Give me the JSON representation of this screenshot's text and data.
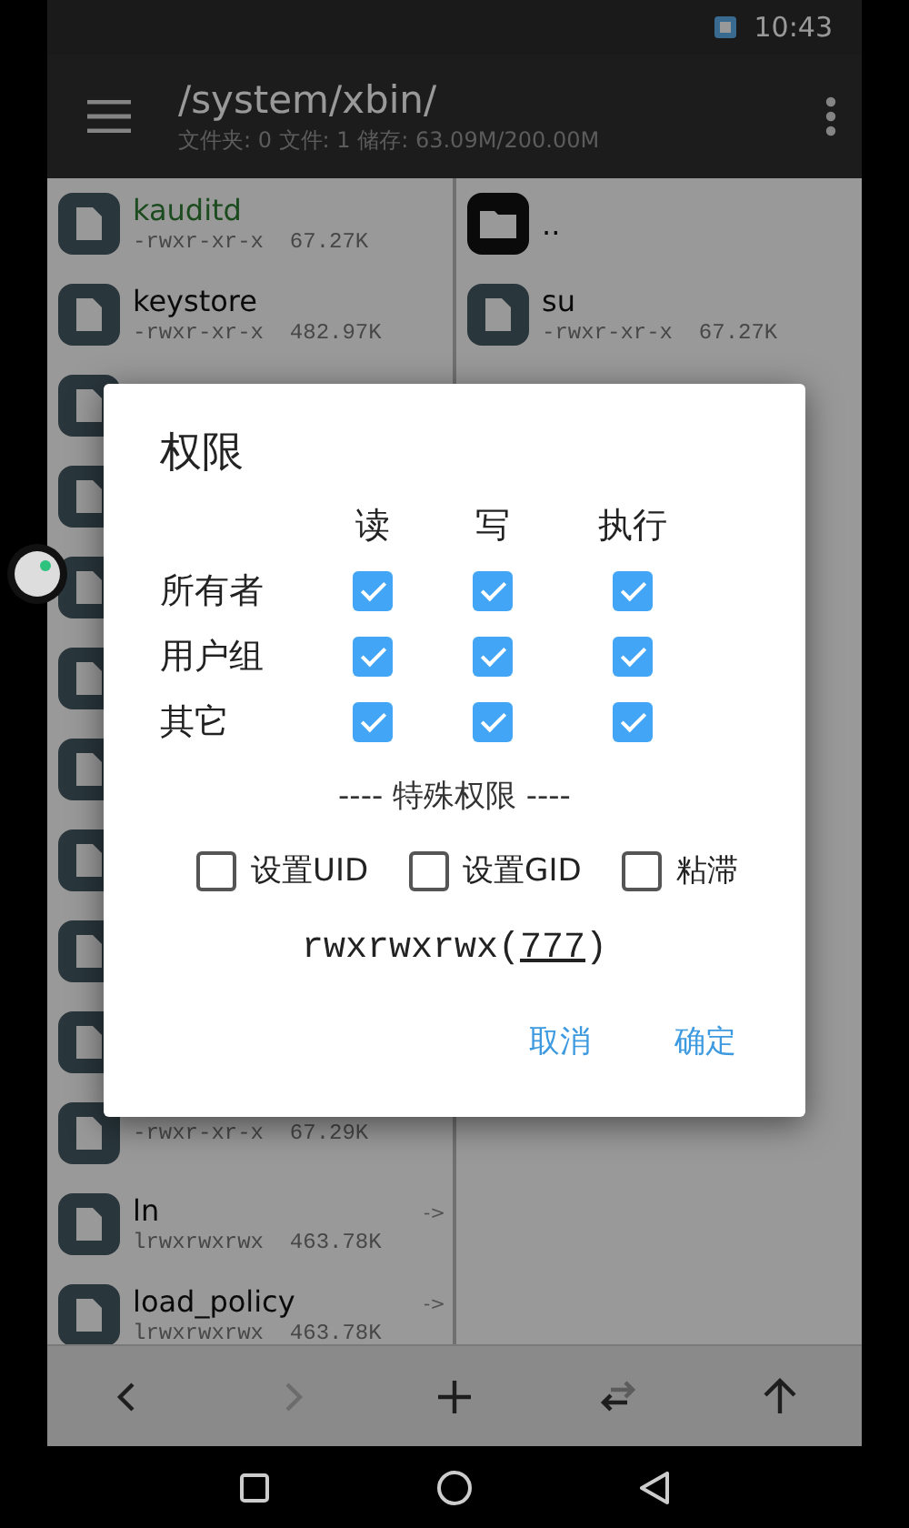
{
  "status_bar": {
    "time": "10:43"
  },
  "toolbar": {
    "path": "/system/xbin/",
    "summary": "文件夹: 0  文件: 1  储存: 63.09M/200.00M"
  },
  "left_pane": {
    "rows": [
      {
        "kind": "file",
        "name": "kauditd",
        "highlighted": true,
        "meta": "-rwxr-xr-x  67.27K"
      },
      {
        "kind": "file",
        "name": "keystore",
        "highlighted": false,
        "meta": "-rwxr-xr-x  482.97K"
      },
      {
        "kind": "file"
      },
      {
        "kind": "file"
      },
      {
        "kind": "file"
      },
      {
        "kind": "file"
      },
      {
        "kind": "file"
      },
      {
        "kind": "file"
      },
      {
        "kind": "file"
      },
      {
        "kind": "file"
      },
      {
        "kind": "file",
        "meta": "-rwxr-xr-x  67.29K"
      },
      {
        "kind": "file",
        "name": "ln",
        "highlighted": false,
        "meta": "lrwxrwxrwx  463.78K",
        "link_mark": "->"
      },
      {
        "kind": "file",
        "name": "load_policy",
        "highlighted": false,
        "meta": "lrwxrwxrwx  463.78K",
        "link_mark": "->"
      }
    ]
  },
  "right_pane": {
    "rows": [
      {
        "kind": "folder",
        "name": ".."
      },
      {
        "kind": "file",
        "name": "su",
        "highlighted": false,
        "meta": "-rwxr-xr-x  67.27K"
      }
    ]
  },
  "dialog": {
    "title": "权限",
    "columns": [
      "读",
      "写",
      "执行"
    ],
    "rows": [
      {
        "label": "所有者",
        "checks": [
          true,
          true,
          true
        ]
      },
      {
        "label": "用户组",
        "checks": [
          true,
          true,
          true
        ]
      },
      {
        "label": "其它",
        "checks": [
          true,
          true,
          true
        ]
      }
    ],
    "special_heading": "---- 特殊权限 ----",
    "special": [
      {
        "label": "设置UID",
        "checked": false
      },
      {
        "label": "设置GID",
        "checked": false
      },
      {
        "label": "粘滞",
        "checked": false
      }
    ],
    "summary": {
      "prefix": "rwxrwxrwx(",
      "octal": "777",
      "suffix": ")"
    },
    "buttons": [
      "取消",
      "确定"
    ]
  },
  "bottom_bar": [
    {
      "kind": "back",
      "disabled": false
    },
    {
      "kind": "forward",
      "disabled": true
    },
    {
      "kind": "add",
      "disabled": false
    },
    {
      "kind": "swap",
      "disabled": false
    },
    {
      "kind": "up",
      "disabled": false
    }
  ]
}
